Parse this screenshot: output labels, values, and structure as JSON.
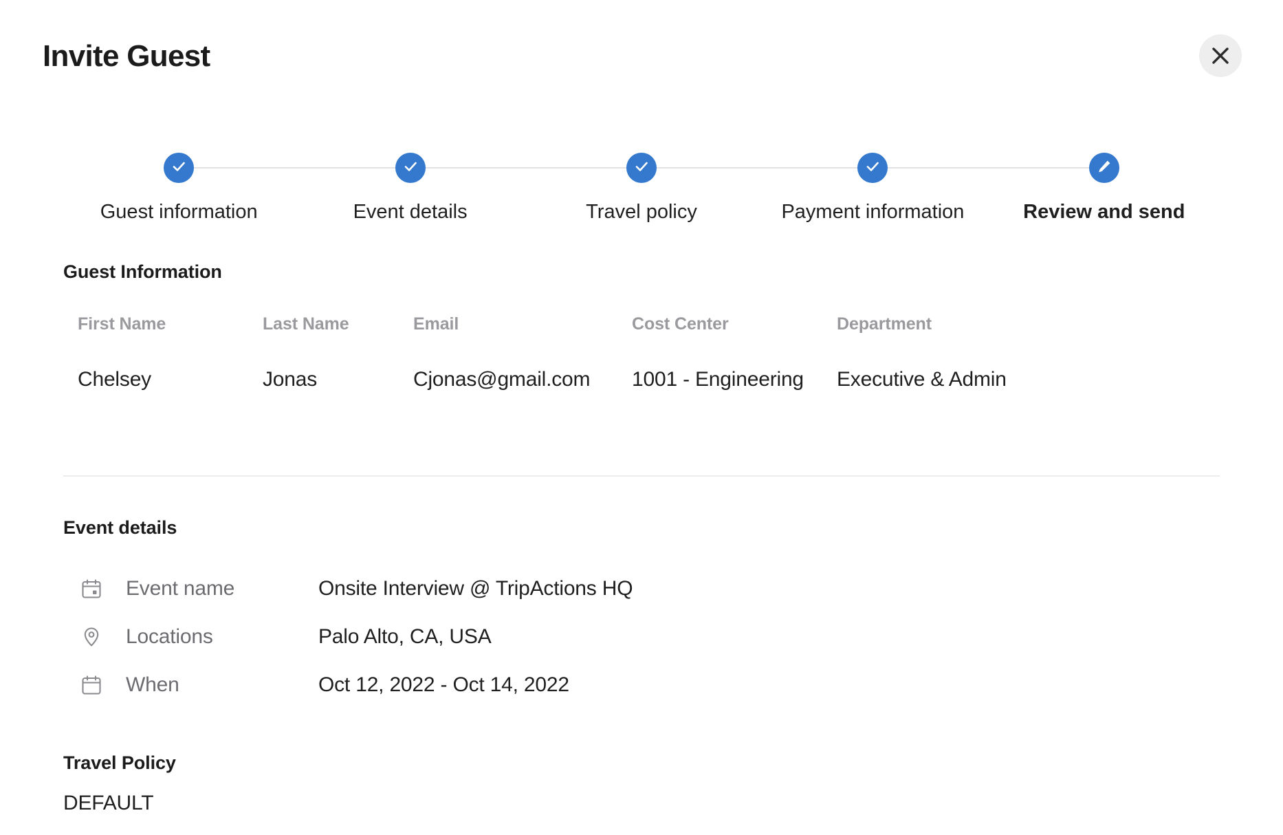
{
  "header": {
    "title": "Invite Guest",
    "close_label": "Close"
  },
  "stepper": {
    "steps": [
      {
        "label": "Guest information",
        "state": "complete",
        "icon": "check-icon"
      },
      {
        "label": "Event details",
        "state": "complete",
        "icon": "check-icon"
      },
      {
        "label": "Travel policy",
        "state": "complete",
        "icon": "check-icon"
      },
      {
        "label": "Payment information",
        "state": "complete",
        "icon": "check-icon"
      },
      {
        "label": "Review and send",
        "state": "current",
        "icon": "pencil-icon"
      }
    ],
    "accent_color": "#3479cd",
    "line_color": "#e2e2e2"
  },
  "guest_information": {
    "heading": "Guest Information",
    "columns": [
      "First Name",
      "Last Name",
      "Email",
      "Cost Center",
      "Department"
    ],
    "values": [
      "Chelsey",
      "Jonas",
      "Cjonas@gmail.com",
      "1001 - Engineering",
      "Executive & Admin"
    ]
  },
  "event_details": {
    "heading": "Event details",
    "rows": [
      {
        "icon": "calendar-event-icon",
        "label": "Event name",
        "value": "Onsite Interview @ TripActions HQ"
      },
      {
        "icon": "location-pin-icon",
        "label": "Locations",
        "value": "Palo Alto, CA, USA"
      },
      {
        "icon": "calendar-icon",
        "label": "When",
        "value": "Oct 12, 2022 - Oct 14, 2022"
      }
    ]
  },
  "travel_policy": {
    "heading": "Travel Policy",
    "value": "DEFAULT"
  }
}
